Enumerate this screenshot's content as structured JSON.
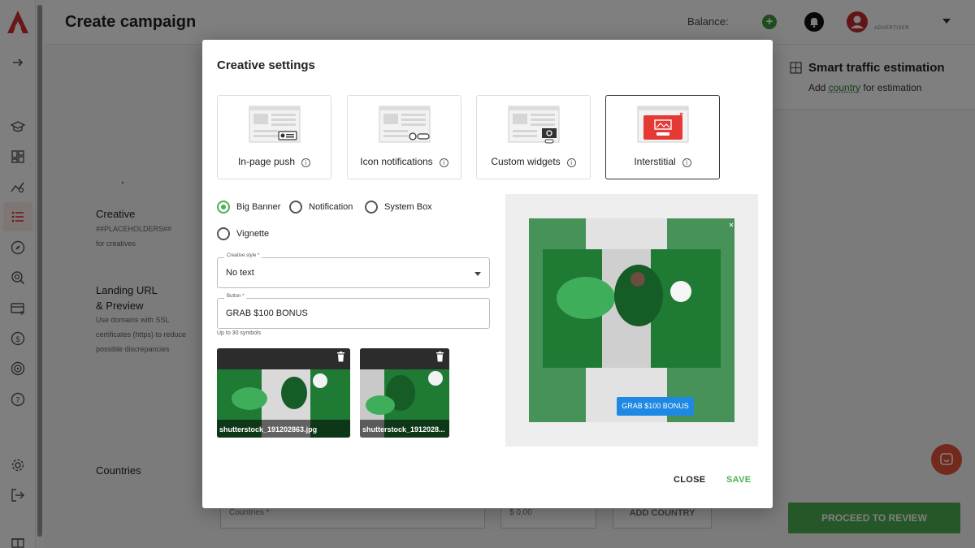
{
  "header": {
    "title": "Create campaign",
    "balance_label": "Balance:",
    "role_label": "ADVERTISER"
  },
  "form": {
    "creative_label": "Creative",
    "creative_sub_1": "##PLACEHOLDERS##",
    "creative_sub_2": "for creatives",
    "landing_label_1": "Landing URL",
    "landing_label_2": "& Preview",
    "landing_sub_1": "Use domains with SSL",
    "landing_sub_2": "certificates (https) to reduce",
    "landing_sub_3": "possible discrepancies",
    "countries_label": "Countries",
    "countries_field": "Countries *",
    "price_field": "$  0.00",
    "add_country": "ADD COUNTRY"
  },
  "right_panel": {
    "title": "Smart traffic estimation",
    "sub_prefix": "Add ",
    "sub_link": "country",
    "sub_suffix": " for estimation",
    "proceed_label": "PROCEED TO REVIEW"
  },
  "modal": {
    "title": "Creative settings",
    "formats": [
      {
        "label": "In-page push"
      },
      {
        "label": "Icon notifications"
      },
      {
        "label": "Custom widgets"
      },
      {
        "label": "Interstitial"
      }
    ],
    "selected_format": "Interstitial",
    "radios": [
      {
        "label": "Big Banner",
        "checked": true
      },
      {
        "label": "Notification",
        "checked": false
      },
      {
        "label": "System Box",
        "checked": false
      },
      {
        "label": "Vignette",
        "checked": false
      }
    ],
    "creative_style": {
      "label": "Creative style *",
      "value": "No text"
    },
    "button_field": {
      "label": "Button *",
      "value": "GRAB $100 BONUS",
      "help": "Up to 30 symbols"
    },
    "images": [
      {
        "filename": "shutterstock_191202863.jpg"
      },
      {
        "filename": "shutterstock_1912028..."
      }
    ],
    "preview_button": "GRAB $100 BONUS",
    "close_label": "CLOSE",
    "save_label": "SAVE"
  },
  "colors": {
    "accent_green": "#4caf50",
    "brand_red": "#c62828",
    "preview_button_blue": "#1e88e5"
  }
}
